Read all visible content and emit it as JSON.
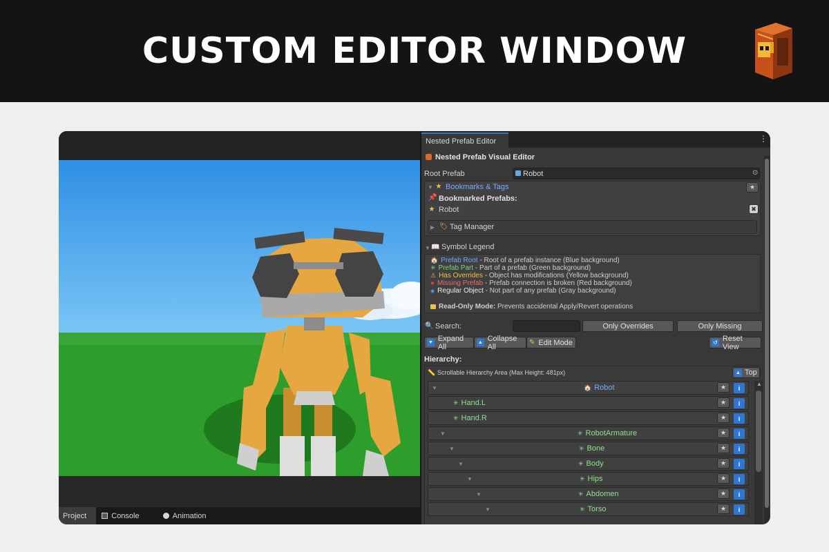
{
  "banner": {
    "title": "CUSTOM EDITOR WINDOW"
  },
  "bottom_tabs": [
    {
      "label": "Project",
      "icon": "folder-icon"
    },
    {
      "label": "Console",
      "icon": "console-icon"
    },
    {
      "label": "Animation",
      "icon": "clock-icon"
    }
  ],
  "panel": {
    "tab_label": "Nested Prefab Editor",
    "menu_glyph": "⋮",
    "title": "Nested Prefab Visual Editor",
    "root_prefab": {
      "label": "Root Prefab",
      "value": "Robot"
    },
    "bookmarks": {
      "header": "Bookmarks & Tags",
      "subheader": "Bookmarked Prefabs:",
      "items": [
        "Robot"
      ],
      "tag_manager": "Tag Manager"
    },
    "legend": {
      "header": "Symbol Legend",
      "lines": [
        {
          "name": "Prefab Root",
          "desc": " - Root of a prefab instance (Blue background)",
          "color": "#6fa8ff",
          "icon": "house-icon",
          "glyph": "🏠"
        },
        {
          "name": "Prefab Part",
          "desc": " - Part of a prefab (Green background)",
          "color": "#7fd67f",
          "icon": "puzzle-icon",
          "glyph": "✳"
        },
        {
          "name": "Has Overrides",
          "desc": " - Object has modifications (Yellow background)",
          "color": "#f0c24a",
          "icon": "warning-icon",
          "glyph": "⚠"
        },
        {
          "name": "Missing Prefab",
          "desc": " - Prefab connection is broken (Red background)",
          "color": "#ef6b6b",
          "icon": "error-icon",
          "glyph": "●"
        },
        {
          "name": "Regular Object",
          "desc": " - Not part of any prefab (Gray background)",
          "color": "#e8e8e8",
          "icon": "diamond-icon",
          "glyph": "◆"
        }
      ],
      "readonly_name": "Read-Only Mode:",
      "readonly_desc": " Prevents accidental Apply/Revert operations"
    },
    "search": {
      "label": "Search:",
      "value": "",
      "only_overrides": "Only Overrides",
      "only_missing": "Only Missing"
    },
    "actions": {
      "expand_all": "Expand All",
      "collapse_all": "Collapse All",
      "edit_mode": "Edit Mode",
      "reset_view": "Reset View"
    },
    "hierarchy": {
      "label": "Hierarchy:",
      "area_label": "Scrollable Hierarchy Area (Max Height: 481px)",
      "top_button": "Top",
      "rows": [
        {
          "name": "Robot",
          "kind": "root",
          "expanded": true
        },
        {
          "name": "Hand.L",
          "kind": "part",
          "expanded": false
        },
        {
          "name": "Hand.R",
          "kind": "part",
          "expanded": false
        },
        {
          "name": "RobotArmature",
          "kind": "part",
          "expanded": true
        },
        {
          "name": "Bone",
          "kind": "part",
          "expanded": true
        },
        {
          "name": "Body",
          "kind": "part",
          "expanded": true
        },
        {
          "name": "Hips",
          "kind": "part",
          "expanded": true
        },
        {
          "name": "Abdomen",
          "kind": "part",
          "expanded": true
        },
        {
          "name": "Torso",
          "kind": "part",
          "expanded": true
        }
      ]
    }
  },
  "colors": {
    "root_text": "#79a9ff",
    "part_text": "#8fe08f",
    "link_blue": "#6fa8ff",
    "accent_blue": "#2e76d2"
  }
}
